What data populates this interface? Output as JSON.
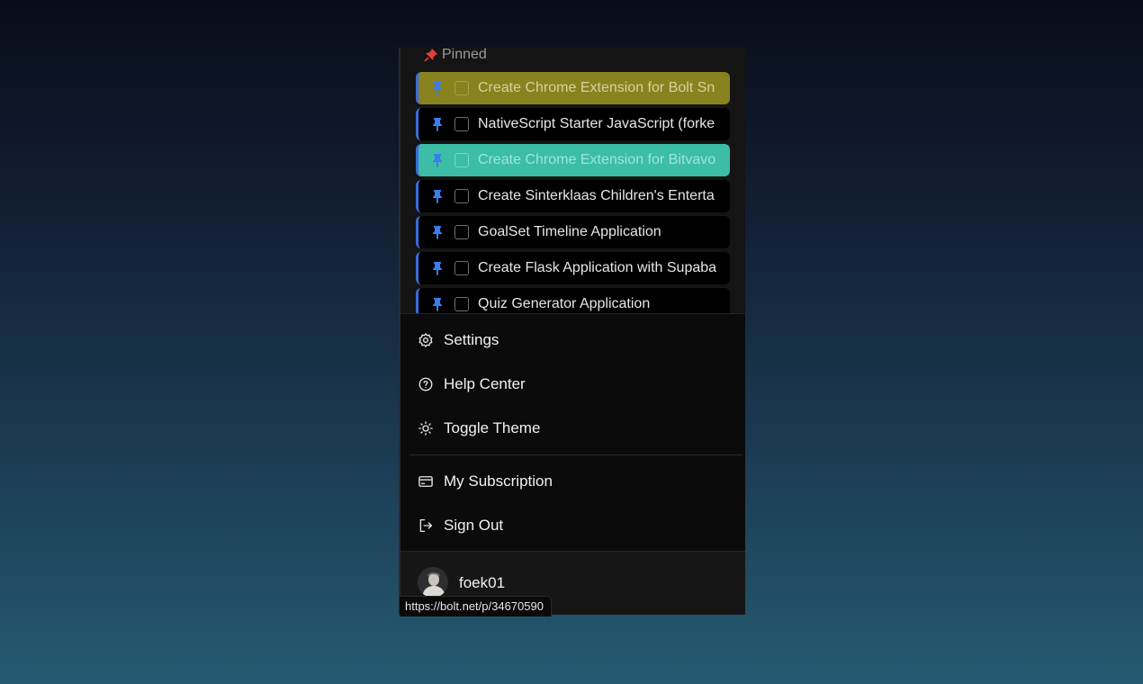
{
  "pinned": {
    "header_label": "Pinned",
    "items": [
      {
        "title": "Create Chrome Extension for Bolt Sn",
        "variant": "yellow"
      },
      {
        "title": "NativeScript Starter JavaScript (forke",
        "variant": "default"
      },
      {
        "title": "Create Chrome Extension for Bitvavo",
        "variant": "teal"
      },
      {
        "title": "Create Sinterklaas Children's Enterta",
        "variant": "default"
      },
      {
        "title": "GoalSet Timeline Application",
        "variant": "default"
      },
      {
        "title": "Create Flask Application with Supaba",
        "variant": "default"
      },
      {
        "title": "Quiz Generator Application",
        "variant": "default"
      }
    ]
  },
  "menu": {
    "settings": "Settings",
    "help_center": "Help Center",
    "toggle_theme": "Toggle Theme",
    "my_subscription": "My Subscription",
    "sign_out": "Sign Out"
  },
  "user": {
    "name": "foek01"
  },
  "status_url": "https://bolt.net/p/34670590",
  "colors": {
    "pin_blue": "#3a7cf0",
    "pin_red": "#e0403a",
    "highlight_yellow": "#88821f",
    "highlight_teal": "#3cbda6"
  }
}
